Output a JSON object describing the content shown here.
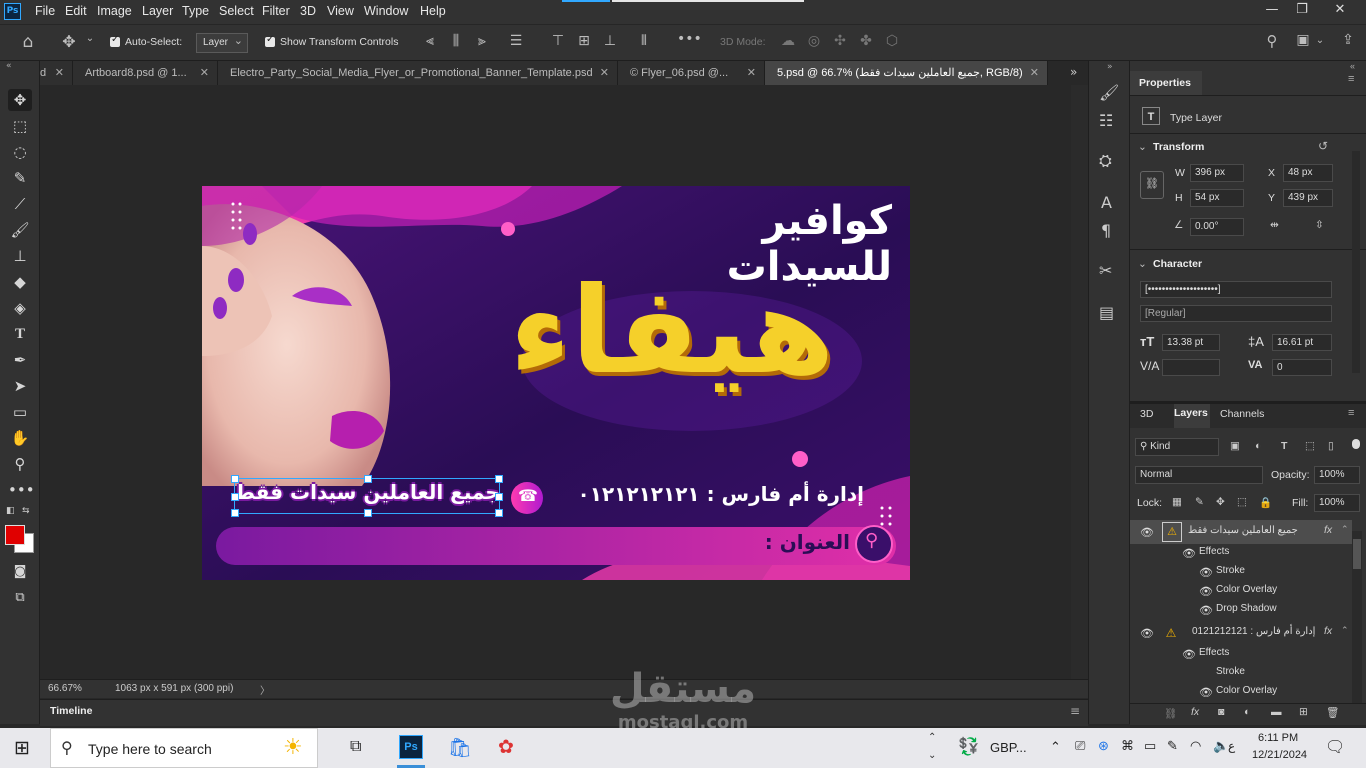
{
  "app": {
    "logo": "Ps",
    "menu": [
      "File",
      "Edit",
      "Image",
      "Layer",
      "Type",
      "Select",
      "Filter",
      "3D",
      "View",
      "Window",
      "Help"
    ]
  },
  "options_bar": {
    "auto_select_label": "Auto-Select:",
    "auto_select_value": "Layer",
    "transform_controls_label": "Show Transform Controls",
    "mode_3d_label": "3D Mode:",
    "more": "•••"
  },
  "tabs": [
    {
      "label": "d"
    },
    {
      "label": "Artboard8.psd @ 1..."
    },
    {
      "label": "Electro_Party_Social_Media_Flyer_or_Promotional_Banner_Template.psd"
    },
    {
      "label": "© Flyer_06.psd @..."
    },
    {
      "label": "5.psd @ 66.7% (جميع العاملين سيدات فقط, RGB/8)",
      "active": true
    }
  ],
  "artboard": {
    "headline": "كوافير للسيدات",
    "brand": "هيفاء",
    "staff_note": "جميع العاملين سيدات فقط",
    "management": "إدارة أم فارس : ٠١٢١٢١٢١٢١",
    "address_label": "العنوان :"
  },
  "status": {
    "zoom": "66.67%",
    "doc_size": "1063 px x 591 px (300 ppi)",
    "arrow": "〉"
  },
  "timeline": {
    "label": "Timeline"
  },
  "properties": {
    "title": "Properties",
    "layer_type": "Type Layer",
    "transform_title": "Transform",
    "w_label": "W",
    "w": "396 px",
    "h_label": "H",
    "h": "54 px",
    "x_label": "X",
    "x": "48 px",
    "y_label": "Y",
    "y": "439 px",
    "angle": "0.00°",
    "character_title": "Character",
    "font_family": "[••••••••••••••••••••]",
    "font_style": "[Regular]",
    "font_size": "13.38 pt",
    "leading": "16.61 pt",
    "kerning_label": "V/A",
    "tracking": "0"
  },
  "layers_panel": {
    "tabs": [
      "3D",
      "Layers",
      "Channels"
    ],
    "active_tab": "Layers",
    "filter": "Kind",
    "blend_mode": "Normal",
    "opacity_label": "Opacity:",
    "opacity": "100%",
    "lock_label": "Lock:",
    "fill_label": "Fill:",
    "fill": "100%",
    "layers": [
      {
        "name": "جميع العاملين سيدات فقط",
        "fx": "fx",
        "effects_label": "Effects",
        "effects": [
          "Stroke",
          "Color Overlay",
          "Drop Shadow"
        ]
      },
      {
        "name": "إدارة أم فارس : 0121212121",
        "fx": "fx",
        "effects_label": "Effects",
        "effects": [
          "Stroke",
          "Color Overlay"
        ]
      }
    ]
  },
  "taskbar": {
    "search_placeholder": "Type here to search",
    "app_label": "GBP...",
    "lang": "ع",
    "time": "6:11 PM",
    "date": "12/21/2024"
  },
  "watermark": {
    "arabic": "مستقل",
    "latin": "mostaql.com"
  },
  "colors": {
    "foreground": "#e00000",
    "background": "#ffffff",
    "accent": "#31a8ff",
    "artboard_purple": "#3a1065",
    "artboard_pink": "#e0259a",
    "brand_yellow": "#f5d02a"
  }
}
